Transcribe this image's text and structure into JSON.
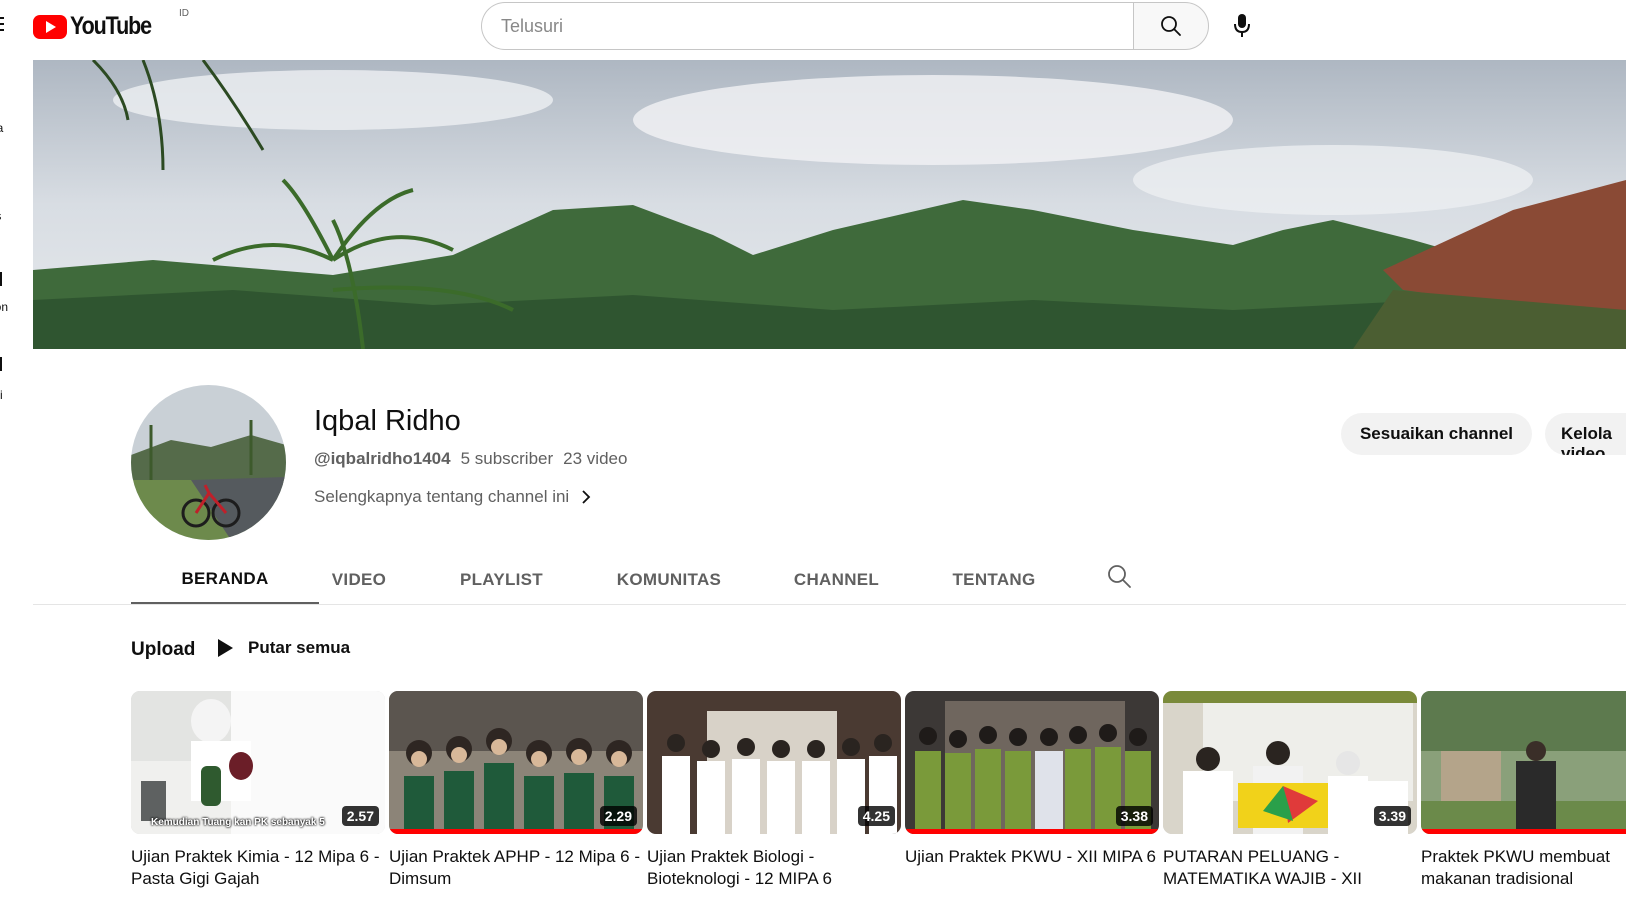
{
  "masthead": {
    "logo_text": "YouTube",
    "country_code": "ID",
    "search_placeholder": "Telusuri"
  },
  "sidebar": {
    "items": [
      "da",
      "ts",
      "otion",
      "si"
    ]
  },
  "channel": {
    "name": "Iqbal Ridho",
    "handle": "@iqbalridho1404",
    "subscribers": "5 subscriber",
    "videos": "23 video",
    "about_link": "Selengkapnya tentang channel ini",
    "customize_label": "Sesuaikan channel",
    "manage_label": "Kelola video"
  },
  "tabs": [
    {
      "label": "BERANDA",
      "active": true
    },
    {
      "label": "VIDEO",
      "active": false
    },
    {
      "label": "PLAYLIST",
      "active": false
    },
    {
      "label": "KOMUNITAS",
      "active": false
    },
    {
      "label": "CHANNEL",
      "active": false
    },
    {
      "label": "TENTANG",
      "active": false
    }
  ],
  "shelf": {
    "title": "Upload",
    "play_all_label": "Putar semua",
    "videos": [
      {
        "title": "Ujian Praktek Kimia - 12 Mipa 6 - Pasta Gigi Gajah",
        "duration": "2.57",
        "caption": "Kemudian Tuang kan PK sebanyak 5"
      },
      {
        "title": "Ujian Praktek APHP - 12 Mipa 6 - Dimsum",
        "duration": "2.29"
      },
      {
        "title": "Ujian Praktek Biologi - Bioteknologi - 12 MIPA 6",
        "duration": "4.25"
      },
      {
        "title": "Ujian Praktek PKWU - XII MIPA 6",
        "duration": "3.38"
      },
      {
        "title": "PUTARAN PELUANG - MATEMATIKA WAJIB - XII",
        "duration": "3.39"
      },
      {
        "title": "Praktek PKWU membuat makanan tradisional",
        "duration": ""
      }
    ]
  },
  "colors": {
    "brand_red": "#ff0000",
    "text_primary": "#0f0f0f",
    "text_secondary": "#606060"
  }
}
